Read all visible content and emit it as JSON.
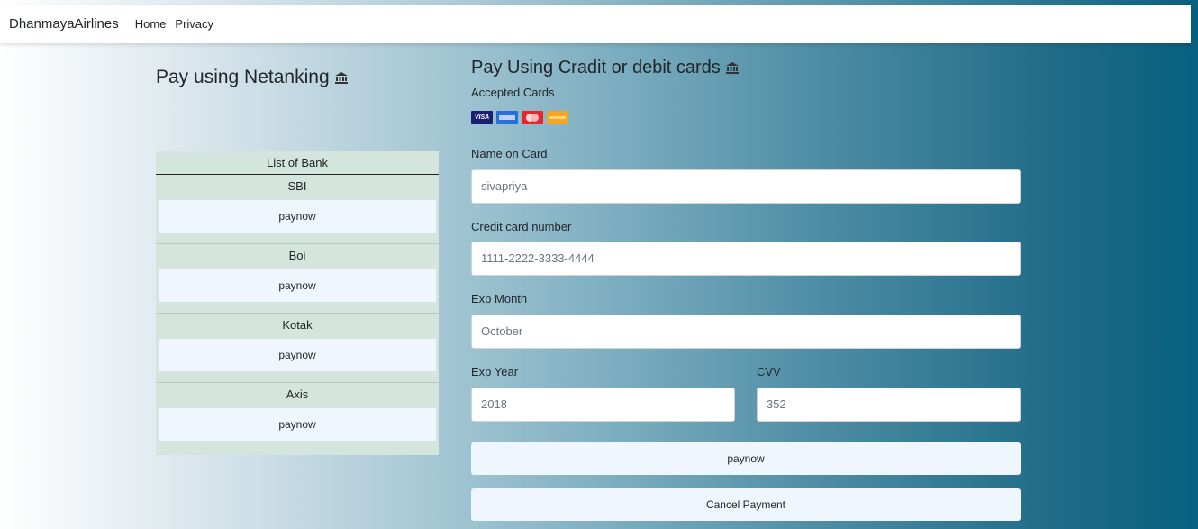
{
  "navbar": {
    "brand": "DhanmayaAirlines",
    "links": [
      "Home",
      "Privacy"
    ]
  },
  "netbanking": {
    "title": "Pay using Netanking",
    "icon": "bank-icon",
    "list_header": "List of Bank",
    "banks": [
      {
        "name": "SBI",
        "button": "paynow"
      },
      {
        "name": "Boi",
        "button": "paynow"
      },
      {
        "name": "Kotak",
        "button": "paynow"
      },
      {
        "name": "Axis",
        "button": "paynow"
      }
    ]
  },
  "card_payment": {
    "title": "Pay Using Cradit or debit cards",
    "icon": "bank-icon",
    "accepted_label": "Accepted Cards",
    "card_icons": [
      "visa-icon",
      "amex-icon",
      "mastercard-icon",
      "discover-icon"
    ],
    "name_label": "Name on Card",
    "name_placeholder": "sivapriya",
    "cc_label": "Credit card number",
    "cc_placeholder": "1111-2222-3333-4444",
    "month_label": "Exp Month",
    "month_placeholder": "October",
    "year_label": "Exp Year",
    "year_placeholder": "2018",
    "cvv_label": "CVV",
    "cvv_placeholder": "352",
    "pay_button": "paynow",
    "cancel_button": "Cancel Payment"
  },
  "colors": {
    "bank_list_bg": "#d3e5dc",
    "button_bg": "#eff6fd",
    "gradient_end": "#07607f"
  }
}
